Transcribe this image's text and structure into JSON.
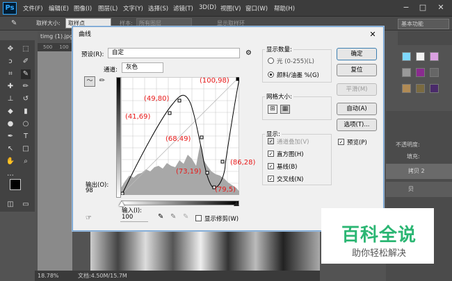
{
  "app": {
    "logo": "Ps"
  },
  "menubar": {
    "items": [
      "文件(F)",
      "编辑(E)",
      "图像(I)",
      "图层(L)",
      "文字(Y)",
      "选择(S)",
      "滤镜(T)",
      "3D(D)",
      "视图(V)",
      "窗口(W)",
      "帮助(H)"
    ],
    "minimize": "−",
    "maximize": "□",
    "close": "✕"
  },
  "options": {
    "sample_size_label": "取样大小:",
    "sample_size_value": "取样点",
    "sample_label": "样本:",
    "sample_value": "所有图层",
    "show_ring_label": "显示取样环",
    "workspace": "基本功能"
  },
  "document": {
    "tab_title": "timg (1).jpg",
    "ruler_marks": [
      "500",
      "100"
    ],
    "zoom": "18.78%",
    "file_info": "文档:4.50M/15.7M"
  },
  "dialog": {
    "title": "曲线",
    "preset_label": "预设(R):",
    "preset_value": "自定",
    "channel_label": "通道:",
    "channel_value": "灰色",
    "output_label": "输出(O):",
    "output_value": "98",
    "input_label": "输入(I):",
    "input_value": "100",
    "show_clipping_label": "显示修剪(W)",
    "buttons": {
      "ok": "确定",
      "reset": "复位",
      "smooth": "平滑(M)",
      "auto": "自动(A)",
      "options": "选项(T)..."
    },
    "preview_label": "预览(P)",
    "display_amount_title": "显示数量:",
    "light_label": "光 (0-255)(L)",
    "pigment_label": "颜料/油墨 %(G)",
    "grid_size_title": "网格大小:",
    "show_title": "显示:",
    "channel_overlay_label": "通道叠加(V)",
    "histogram_label": "直方图(H)",
    "baseline_label": "基线(B)",
    "intersection_label": "交叉线(N)"
  },
  "curve_points_annotations": [
    "(41,69)",
    "(49,80)",
    "(68,49)",
    "(73,19)",
    "(79,5)",
    "(86,28)",
    "(100,98)"
  ],
  "watermark": {
    "line1": "百科全说",
    "line2": "助你轻松解决"
  },
  "layers": {
    "opacity_label": "不透明度:",
    "fill_label": "填充:",
    "layer1": "拷贝 2",
    "layer2": "贝"
  },
  "colors": {
    "accent": "#31a8ff",
    "annotation": "#e81818",
    "watermark": "#2bb673"
  }
}
